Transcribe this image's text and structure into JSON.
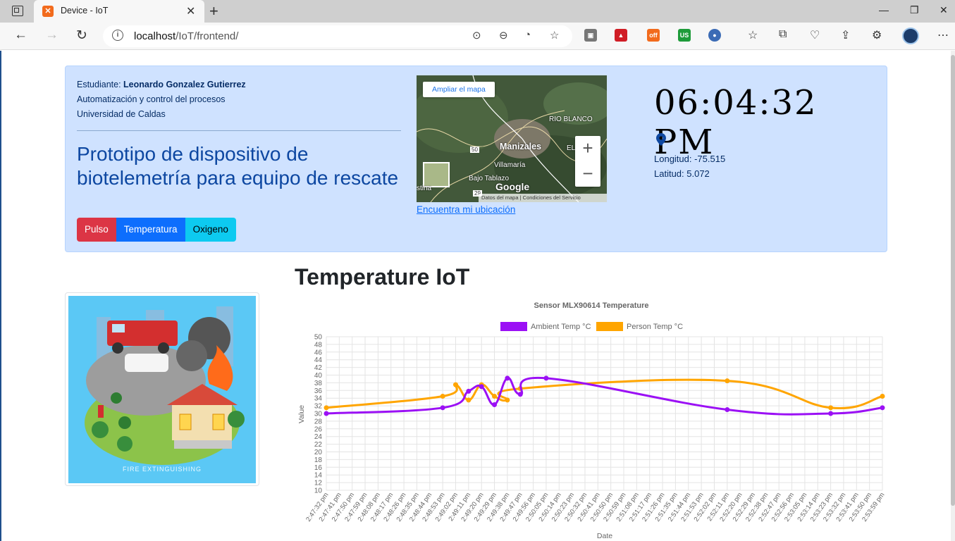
{
  "browser": {
    "tab_title": "Device - IoT",
    "url_host": "localhost",
    "url_path": "/IoT/frontend/",
    "ext_off_label": "off",
    "ext_us_label": "US"
  },
  "header": {
    "student_label": "Estudiante:",
    "student_name": "Leonardo Gonzalez Gutierrez",
    "program": "Automatización y control del procesos",
    "university": "Universidad de Caldas",
    "title": "Prototipo de dispositivo de biotelemetría para equipo de rescate",
    "buttons": [
      "Pulso",
      "Temperatura",
      "Oxigeno"
    ]
  },
  "map": {
    "enlarge_label": "Ampliar el mapa",
    "labels": [
      "RIO BLANCO",
      "Manizales",
      "EL RO",
      "Villamaría",
      "Bajo Tablazo",
      "stina",
      "50",
      "29"
    ],
    "footer_data": "Datos del mapa",
    "footer_terms": "Condiciones del Servicio",
    "google_label": "Google",
    "locate_link": "Encuentra mi ubicación"
  },
  "clock": {
    "time": "06:04:32 PM",
    "longitude": "Longitud: -75.515",
    "latitude": "Latitud: 5.072"
  },
  "section": {
    "title": "Temperature IoT",
    "image_caption": "FIRE EXTINGUISHING"
  },
  "chart_data": {
    "type": "line",
    "title": "Sensor MLX90614 Temperature",
    "xlabel": "Date",
    "ylabel": "Value",
    "ylim": [
      10,
      50
    ],
    "y_step": 2,
    "grid": true,
    "legend_position": "top",
    "categories": [
      "2:47:32 pm",
      "2:47:41 pm",
      "2:47:50 pm",
      "2:47:59 pm",
      "2:48:08 pm",
      "2:48:17 pm",
      "2:48:26 pm",
      "2:48:35 pm",
      "2:48:44 pm",
      "2:48:53 pm",
      "2:49:02 pm",
      "2:49:11 pm",
      "2:49:20 pm",
      "2:49:29 pm",
      "2:49:38 pm",
      "2:49:47 pm",
      "2:49:56 pm",
      "2:50:05 pm",
      "2:50:14 pm",
      "2:50:23 pm",
      "2:50:32 pm",
      "2:50:41 pm",
      "2:50:50 pm",
      "2:50:59 pm",
      "2:51:08 pm",
      "2:51:17 pm",
      "2:51:26 pm",
      "2:51:35 pm",
      "2:51:44 pm",
      "2:51:53 pm",
      "2:52:02 pm",
      "2:52:11 pm",
      "2:52:20 pm",
      "2:52:29 pm",
      "2:52:38 pm",
      "2:52:47 pm",
      "2:52:56 pm",
      "2:53:05 pm",
      "2:53:14 pm",
      "2:53:23 pm",
      "2:53:32 pm",
      "2:53:41 pm",
      "2:53:50 pm",
      "2:53:59 pm"
    ],
    "series": [
      {
        "name": "Ambient Temp °C",
        "color": "#9b10f5",
        "points": [
          [
            0,
            30
          ],
          [
            9,
            31.5
          ],
          [
            11,
            35.8
          ],
          [
            12,
            37
          ],
          [
            13,
            32.3
          ],
          [
            14,
            39.2
          ],
          [
            15,
            35
          ],
          [
            17,
            39.2
          ],
          [
            31,
            31
          ],
          [
            39,
            30
          ],
          [
            43,
            31.5
          ]
        ]
      },
      {
        "name": "Person Temp °C",
        "color": "#ffa500",
        "points": [
          [
            0,
            31.5
          ],
          [
            9,
            34.5
          ],
          [
            10,
            37.5
          ],
          [
            11,
            33.5
          ],
          [
            12,
            37.5
          ],
          [
            13,
            34.5
          ],
          [
            14,
            33.5
          ],
          [
            15,
            36.5
          ],
          [
            31,
            38.5
          ],
          [
            39,
            31.5
          ],
          [
            43,
            34.5
          ]
        ]
      }
    ]
  }
}
